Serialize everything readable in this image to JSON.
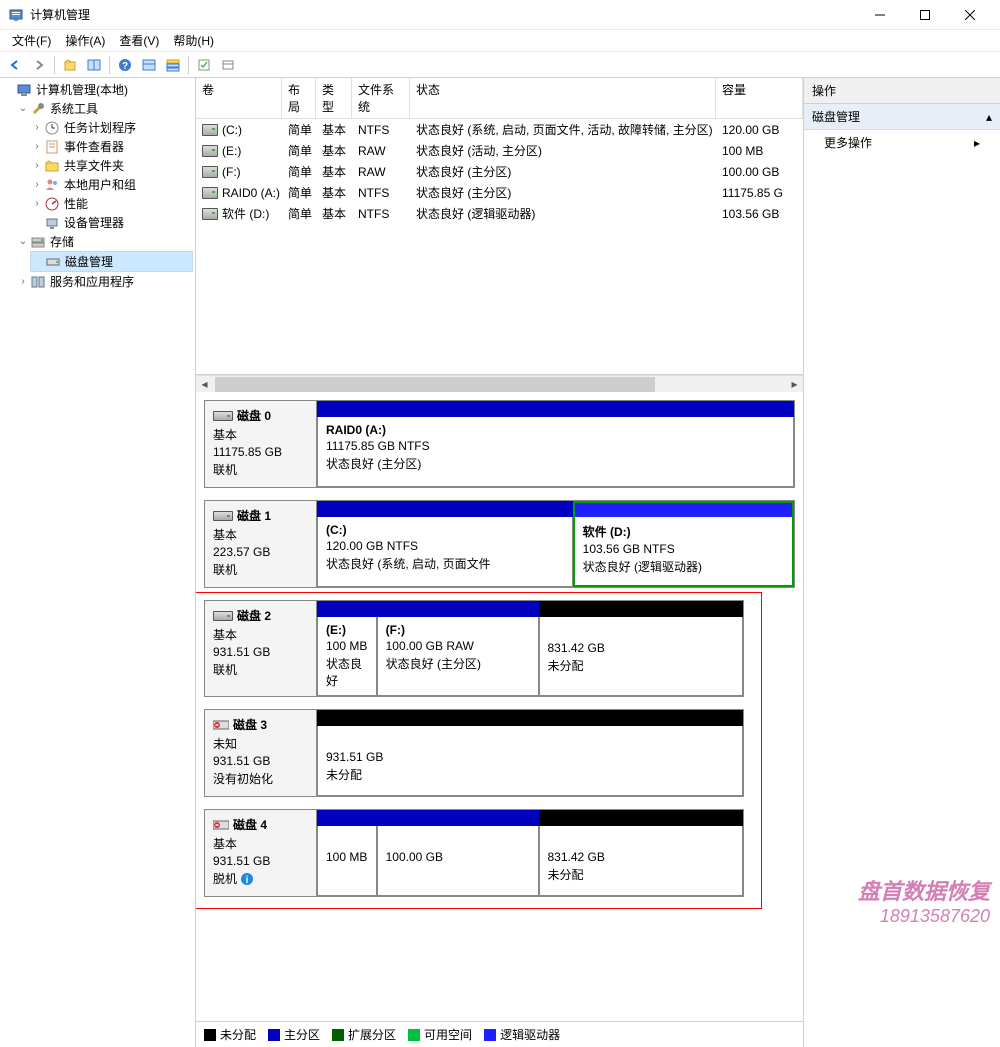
{
  "window": {
    "title": "计算机管理"
  },
  "menu": {
    "file": "文件(F)",
    "action": "操作(A)",
    "view": "查看(V)",
    "help": "帮助(H)"
  },
  "tree": {
    "root": "计算机管理(本地)",
    "system_tools": "系统工具",
    "task_scheduler": "任务计划程序",
    "event_viewer": "事件查看器",
    "shared_folders": "共享文件夹",
    "local_users": "本地用户和组",
    "performance": "性能",
    "device_manager": "设备管理器",
    "storage": "存储",
    "disk_management": "磁盘管理",
    "services_apps": "服务和应用程序"
  },
  "vol_headers": {
    "volume": "卷",
    "layout": "布局",
    "type": "类型",
    "fs": "文件系统",
    "status": "状态",
    "capacity": "容量"
  },
  "volumes": [
    {
      "name": "(C:)",
      "layout": "简单",
      "type": "基本",
      "fs": "NTFS",
      "status": "状态良好 (系统, 启动, 页面文件, 活动, 故障转储, 主分区)",
      "capacity": "120.00 GB"
    },
    {
      "name": "(E:)",
      "layout": "简单",
      "type": "基本",
      "fs": "RAW",
      "status": "状态良好 (活动, 主分区)",
      "capacity": "100 MB"
    },
    {
      "name": "(F:)",
      "layout": "简单",
      "type": "基本",
      "fs": "RAW",
      "status": "状态良好 (主分区)",
      "capacity": "100.00 GB"
    },
    {
      "name": "RAID0 (A:)",
      "layout": "简单",
      "type": "基本",
      "fs": "NTFS",
      "status": "状态良好 (主分区)",
      "capacity": "11175.85 G"
    },
    {
      "name": "软件 (D:)",
      "layout": "简单",
      "type": "基本",
      "fs": "NTFS",
      "status": "状态良好 (逻辑驱动器)",
      "capacity": "103.56 GB"
    }
  ],
  "disks": {
    "d0": {
      "name": "磁盘 0",
      "type": "基本",
      "size": "11175.85 GB",
      "status": "联机"
    },
    "d0p0": {
      "name": "RAID0  (A:)",
      "l1": "11175.85 GB NTFS",
      "l2": "状态良好 (主分区)"
    },
    "d1": {
      "name": "磁盘 1",
      "type": "基本",
      "size": "223.57 GB",
      "status": "联机"
    },
    "d1p0": {
      "name": "(C:)",
      "l1": "120.00 GB NTFS",
      "l2": "状态良好 (系统, 启动, 页面文件"
    },
    "d1p1": {
      "name": "软件  (D:)",
      "l1": "103.56 GB NTFS",
      "l2": "状态良好 (逻辑驱动器)"
    },
    "d2": {
      "name": "磁盘 2",
      "type": "基本",
      "size": "931.51 GB",
      "status": "联机"
    },
    "d2p0": {
      "name": "(E:)",
      "l1": "100 MB",
      "l2": "状态良好"
    },
    "d2p1": {
      "name": "(F:)",
      "l1": "100.00 GB RAW",
      "l2": "状态良好 (主分区)"
    },
    "d2p2": {
      "l1": "831.42 GB",
      "l2": "未分配"
    },
    "d3": {
      "name": "磁盘 3",
      "type": "未知",
      "size": "931.51 GB",
      "status": "没有初始化"
    },
    "d3p0": {
      "l1": "931.51 GB",
      "l2": "未分配"
    },
    "d4": {
      "name": "磁盘 4",
      "type": "基本",
      "size": "931.51 GB",
      "status": "脱机"
    },
    "d4p0": {
      "l1": "100 MB"
    },
    "d4p1": {
      "l1": "100.00 GB"
    },
    "d4p2": {
      "l1": "831.42 GB",
      "l2": "未分配"
    }
  },
  "legend": {
    "unalloc": "未分配",
    "primary": "主分区",
    "extended": "扩展分区",
    "free": "可用空间",
    "logical": "逻辑驱动器"
  },
  "actions": {
    "header": "操作",
    "disk_mgmt": "磁盘管理",
    "more": "更多操作"
  },
  "watermark": {
    "l1": "盘首数据恢复",
    "l2": "18913587620"
  }
}
